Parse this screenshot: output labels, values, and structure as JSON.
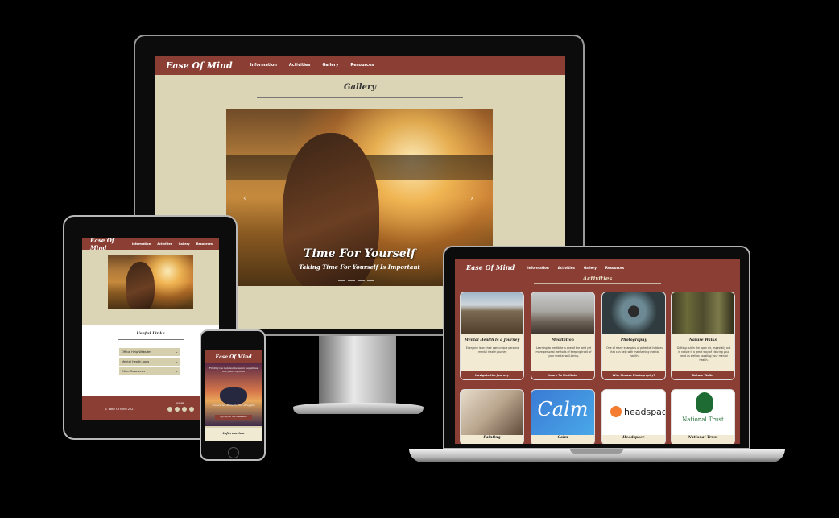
{
  "desktop": {
    "brand": "Ease Of Mind",
    "nav": [
      "Information",
      "Activities",
      "Gallery",
      "Resources"
    ],
    "gallery_title": "Gallery",
    "caption_title": "Time For Yourself",
    "caption_sub": "Taking Time For Yourself Is Important",
    "prev_icon": "‹",
    "next_icon": "›"
  },
  "tablet": {
    "brand": "Ease Of Mind",
    "nav": [
      "Information",
      "Activities",
      "Gallery",
      "Resources"
    ],
    "useful_title": "Useful Links",
    "accordion": [
      "Offical Help Websites",
      "Mental Health Apps",
      "Other Resources"
    ],
    "copyright": "© Ease Of Mind 2021",
    "socials_label": "Socials"
  },
  "phone": {
    "brand": "Ease Of Mind",
    "hero_text_1": "Finding the balance between happiness and peace of mind",
    "hero_text_2": "You are not alone in your struggles",
    "cta": "Sign Up For Our Newsletter",
    "section": "Information"
  },
  "laptop": {
    "brand": "Ease Of Mind",
    "nav": [
      "Information",
      "Activities",
      "Gallery",
      "Resources"
    ],
    "section_title": "Activities",
    "cards": [
      {
        "title": "Mental Health Is a Journey",
        "text": "Everyone is on their own unique personal mental health journey.",
        "button": "Navigate the Journey"
      },
      {
        "title": "Meditation",
        "text": "Learning to meditate is one of the best yet more personal methods of keeping track of your mental well-being.",
        "button": "Learn To Meditate"
      },
      {
        "title": "Photography",
        "text": "One of many examples of potential hobbies that can help with maintaining mental health.",
        "button": "Why Choose Photography?"
      },
      {
        "title": "Nature Walks",
        "text": "Getting out in the open air, especially out in nature is a great way of clearing your head as well as boosting your mental health.",
        "button": "Nature Walks"
      }
    ],
    "cards_row2": [
      {
        "title": "Painting",
        "logo": ""
      },
      {
        "title": "Calm",
        "logo": "Calm"
      },
      {
        "title": "Headspace",
        "logo": "headspace"
      },
      {
        "title": "National Trust",
        "logo": "National Trust"
      }
    ]
  },
  "colors": {
    "brand": "#8b3e34",
    "background": "#dcd5b5",
    "card": "#f2ead2"
  }
}
